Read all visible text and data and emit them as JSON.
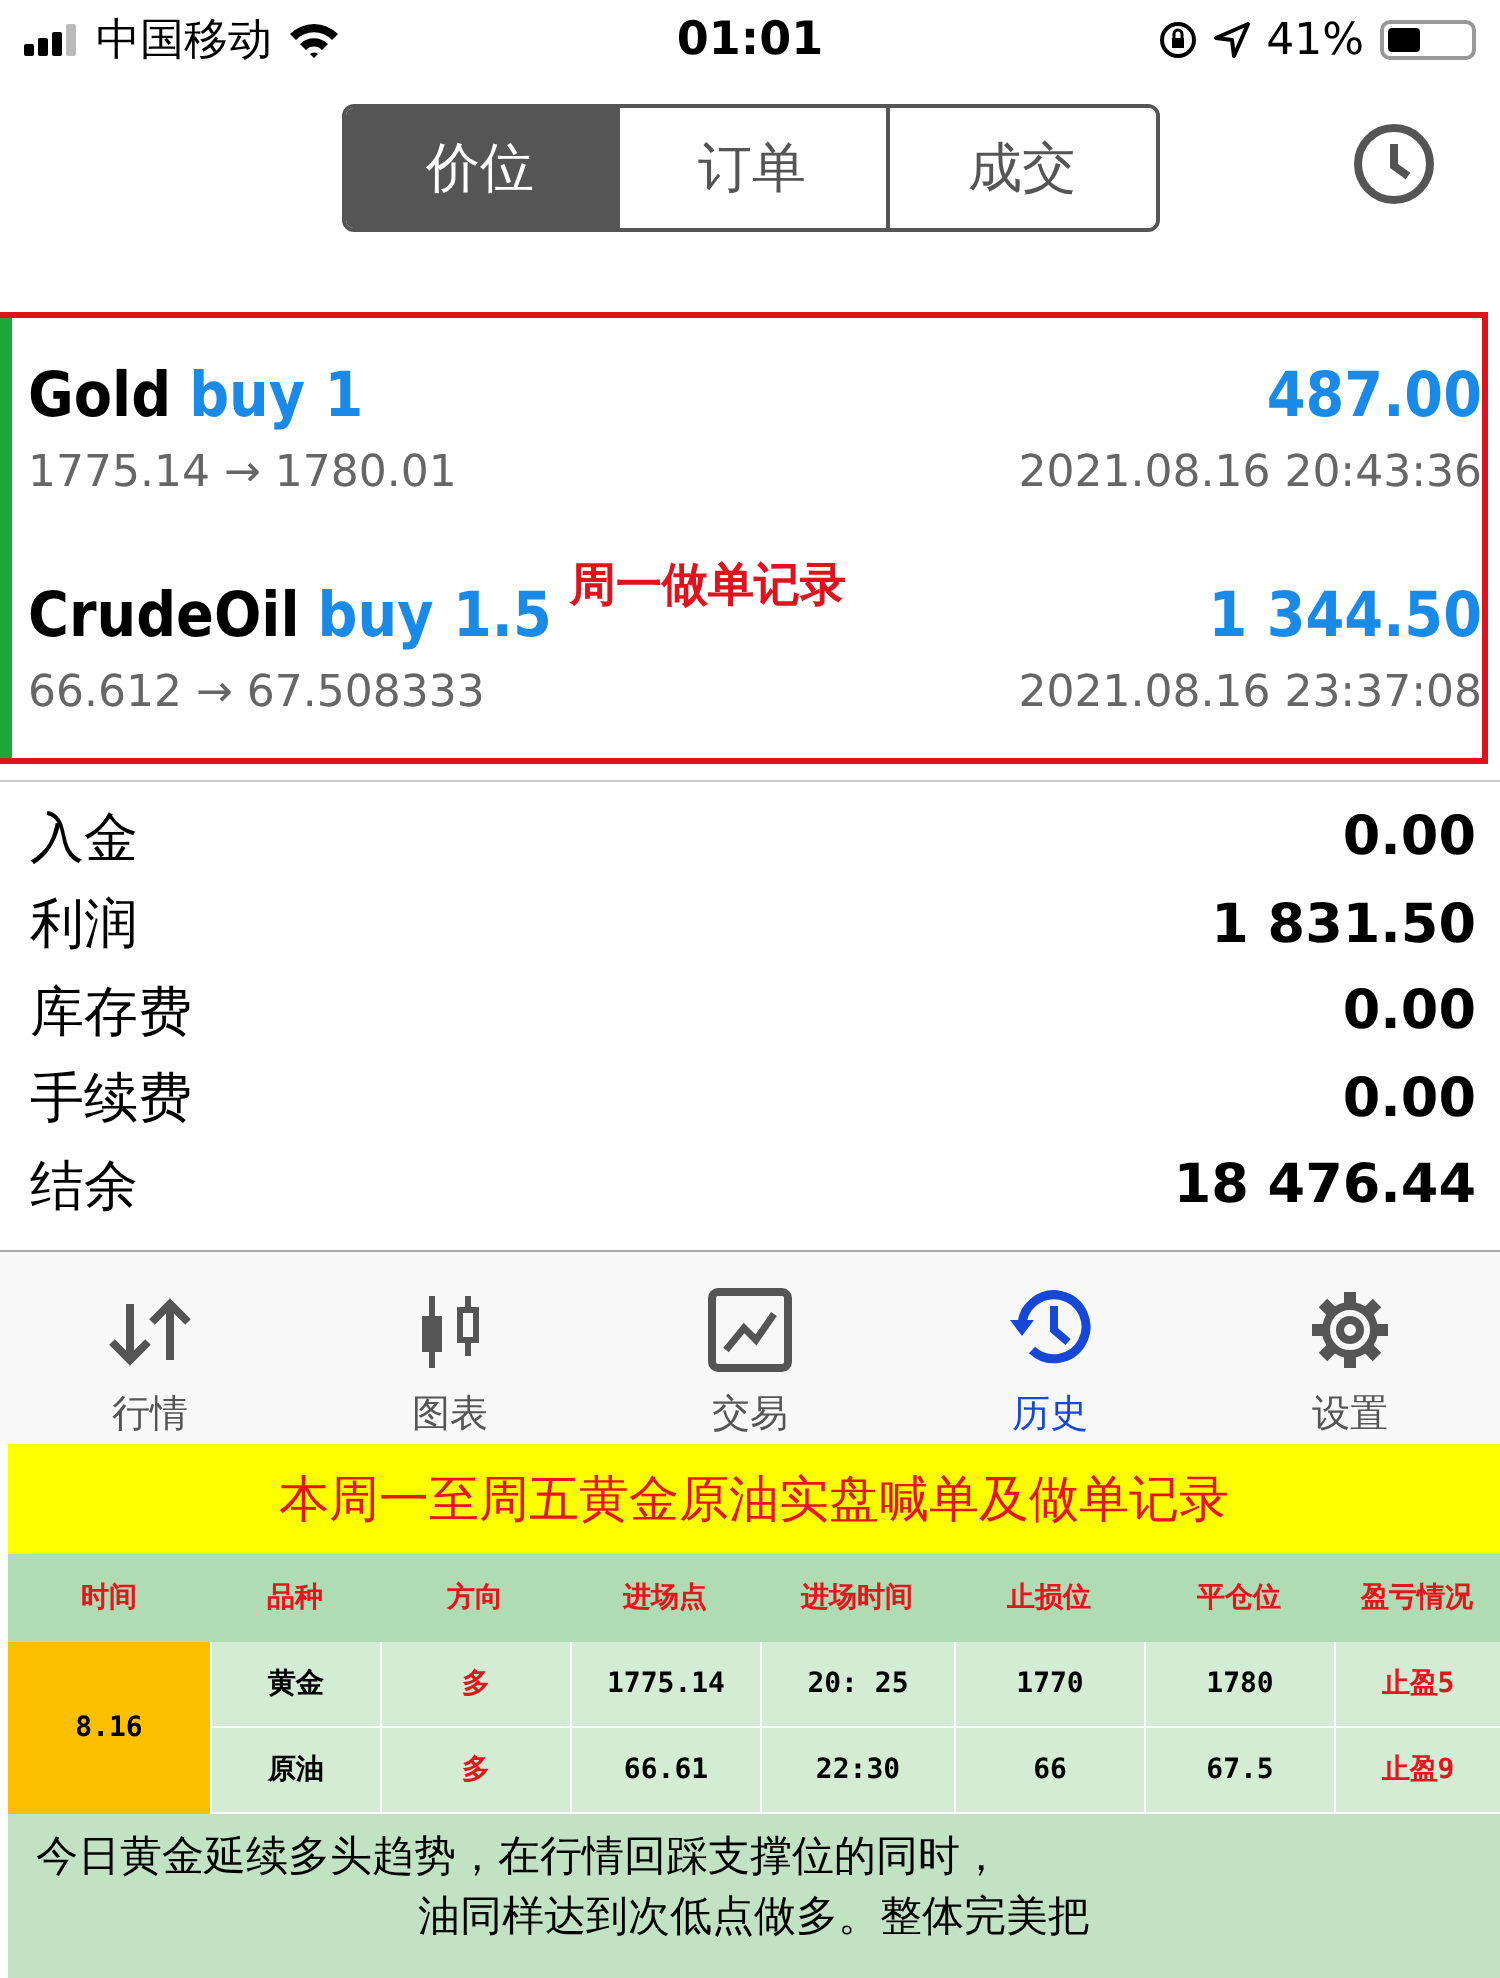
{
  "status_bar": {
    "carrier": "中国移动",
    "time": "01:01",
    "battery": "41%"
  },
  "segments": [
    {
      "label": "价位",
      "selected": true
    },
    {
      "label": "订单",
      "selected": false
    },
    {
      "label": "成交",
      "selected": false
    }
  ],
  "deals": [
    {
      "symbol": "Gold",
      "side": "buy 1",
      "profit": "487.00",
      "prices": "1775.14 → 1780.01",
      "time": "2021.08.16 20:43:36"
    },
    {
      "symbol": "CrudeOil",
      "side": "buy 1.5",
      "profit": "1 344.50",
      "prices": "66.612 → 67.508333",
      "time": "2021.08.16 23:37:08"
    }
  ],
  "annotation": "周一做单记录",
  "summary": [
    {
      "label": "入金",
      "value": "0.00"
    },
    {
      "label": "利润",
      "value": "1 831.50"
    },
    {
      "label": "库存费",
      "value": "0.00"
    },
    {
      "label": "手续费",
      "value": "0.00"
    },
    {
      "label": "结余",
      "value": "18 476.44"
    }
  ],
  "tab_bar": [
    {
      "label": "行情",
      "kind": "quotes",
      "selected": false
    },
    {
      "label": "图表",
      "kind": "chart",
      "selected": false
    },
    {
      "label": "交易",
      "kind": "trade",
      "selected": false
    },
    {
      "label": "历史",
      "kind": "history",
      "selected": true
    },
    {
      "label": "设置",
      "kind": "settings",
      "selected": false
    }
  ],
  "record": {
    "title": "本周一至周五黄金原油实盘喊单及做单记录",
    "columns": [
      "时间",
      "品种",
      "方向",
      "进场点",
      "进场时间",
      "止损位",
      "平仓位",
      "盈亏情况"
    ],
    "rows": [
      [
        "8.16",
        "黄金",
        "多",
        "1775.14",
        "20:  25",
        "1770",
        "1780",
        "止盈5"
      ],
      [
        "",
        "原油",
        "多",
        "66.61",
        "22:30",
        "66",
        "67.5",
        "止盈9"
      ]
    ],
    "note": [
      "今日黄金延续多头趋势，在行情回踩支撑位的同时，",
      "油同样达到次低点做多。整体完美把"
    ]
  }
}
